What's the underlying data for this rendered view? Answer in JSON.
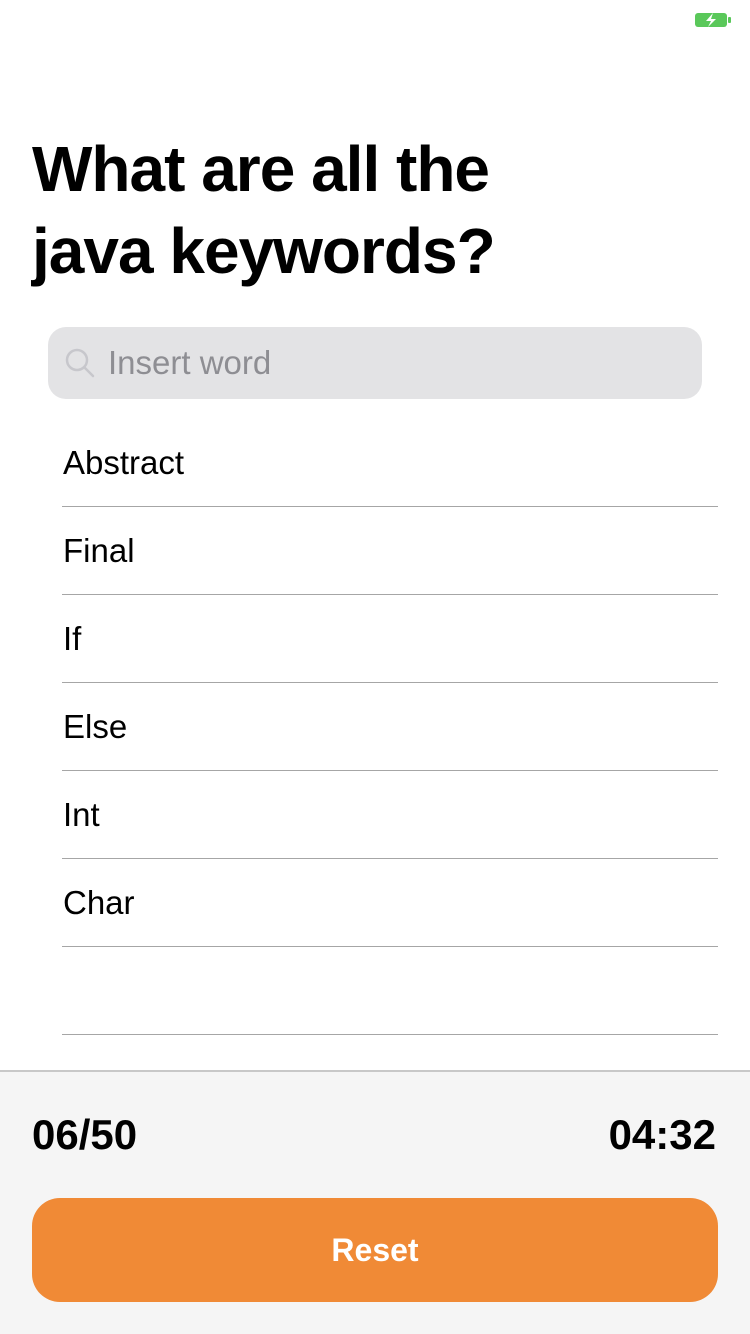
{
  "status_bar": {
    "battery_icon": "battery-charging-icon",
    "battery_color": "#5ac85a"
  },
  "question": {
    "line1": "What are all the",
    "line2": "java keywords?"
  },
  "search": {
    "placeholder": "Insert word",
    "value": "",
    "icon": "search-icon"
  },
  "words": [
    {
      "label": "Abstract"
    },
    {
      "label": "Final"
    },
    {
      "label": "If"
    },
    {
      "label": "Else"
    },
    {
      "label": "Int"
    },
    {
      "label": "Char"
    },
    {
      "label": ""
    }
  ],
  "footer": {
    "count": "06/50",
    "timer": "04:32",
    "reset_label": "Reset"
  },
  "colors": {
    "accent": "#f08a36",
    "search_bg": "#e3e3e5",
    "footer_bg": "#f5f5f5"
  }
}
